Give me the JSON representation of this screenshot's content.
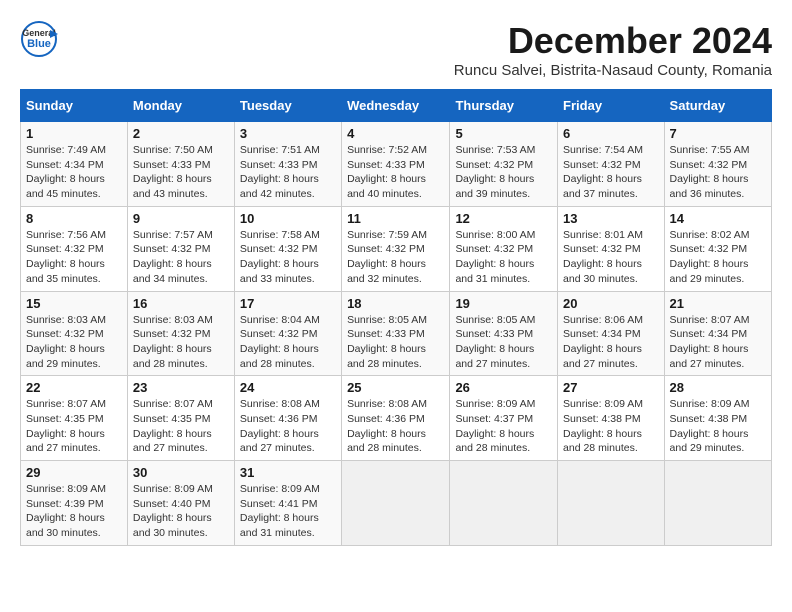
{
  "header": {
    "logo_general": "General",
    "logo_blue": "Blue",
    "month_title": "December 2024",
    "subtitle": "Runcu Salvei, Bistrita-Nasaud County, Romania"
  },
  "days_of_week": [
    "Sunday",
    "Monday",
    "Tuesday",
    "Wednesday",
    "Thursday",
    "Friday",
    "Saturday"
  ],
  "weeks": [
    [
      {
        "day": "1",
        "rise": "7:49 AM",
        "set": "4:34 PM",
        "daylight": "8 hours and 45 minutes."
      },
      {
        "day": "2",
        "rise": "7:50 AM",
        "set": "4:33 PM",
        "daylight": "8 hours and 43 minutes."
      },
      {
        "day": "3",
        "rise": "7:51 AM",
        "set": "4:33 PM",
        "daylight": "8 hours and 42 minutes."
      },
      {
        "day": "4",
        "rise": "7:52 AM",
        "set": "4:33 PM",
        "daylight": "8 hours and 40 minutes."
      },
      {
        "day": "5",
        "rise": "7:53 AM",
        "set": "4:32 PM",
        "daylight": "8 hours and 39 minutes."
      },
      {
        "day": "6",
        "rise": "7:54 AM",
        "set": "4:32 PM",
        "daylight": "8 hours and 37 minutes."
      },
      {
        "day": "7",
        "rise": "7:55 AM",
        "set": "4:32 PM",
        "daylight": "8 hours and 36 minutes."
      }
    ],
    [
      {
        "day": "8",
        "rise": "7:56 AM",
        "set": "4:32 PM",
        "daylight": "8 hours and 35 minutes."
      },
      {
        "day": "9",
        "rise": "7:57 AM",
        "set": "4:32 PM",
        "daylight": "8 hours and 34 minutes."
      },
      {
        "day": "10",
        "rise": "7:58 AM",
        "set": "4:32 PM",
        "daylight": "8 hours and 33 minutes."
      },
      {
        "day": "11",
        "rise": "7:59 AM",
        "set": "4:32 PM",
        "daylight": "8 hours and 32 minutes."
      },
      {
        "day": "12",
        "rise": "8:00 AM",
        "set": "4:32 PM",
        "daylight": "8 hours and 31 minutes."
      },
      {
        "day": "13",
        "rise": "8:01 AM",
        "set": "4:32 PM",
        "daylight": "8 hours and 30 minutes."
      },
      {
        "day": "14",
        "rise": "8:02 AM",
        "set": "4:32 PM",
        "daylight": "8 hours and 29 minutes."
      }
    ],
    [
      {
        "day": "15",
        "rise": "8:03 AM",
        "set": "4:32 PM",
        "daylight": "8 hours and 29 minutes."
      },
      {
        "day": "16",
        "rise": "8:03 AM",
        "set": "4:32 PM",
        "daylight": "8 hours and 28 minutes."
      },
      {
        "day": "17",
        "rise": "8:04 AM",
        "set": "4:32 PM",
        "daylight": "8 hours and 28 minutes."
      },
      {
        "day": "18",
        "rise": "8:05 AM",
        "set": "4:33 PM",
        "daylight": "8 hours and 28 minutes."
      },
      {
        "day": "19",
        "rise": "8:05 AM",
        "set": "4:33 PM",
        "daylight": "8 hours and 27 minutes."
      },
      {
        "day": "20",
        "rise": "8:06 AM",
        "set": "4:34 PM",
        "daylight": "8 hours and 27 minutes."
      },
      {
        "day": "21",
        "rise": "8:07 AM",
        "set": "4:34 PM",
        "daylight": "8 hours and 27 minutes."
      }
    ],
    [
      {
        "day": "22",
        "rise": "8:07 AM",
        "set": "4:35 PM",
        "daylight": "8 hours and 27 minutes."
      },
      {
        "day": "23",
        "rise": "8:07 AM",
        "set": "4:35 PM",
        "daylight": "8 hours and 27 minutes."
      },
      {
        "day": "24",
        "rise": "8:08 AM",
        "set": "4:36 PM",
        "daylight": "8 hours and 27 minutes."
      },
      {
        "day": "25",
        "rise": "8:08 AM",
        "set": "4:36 PM",
        "daylight": "8 hours and 28 minutes."
      },
      {
        "day": "26",
        "rise": "8:09 AM",
        "set": "4:37 PM",
        "daylight": "8 hours and 28 minutes."
      },
      {
        "day": "27",
        "rise": "8:09 AM",
        "set": "4:38 PM",
        "daylight": "8 hours and 28 minutes."
      },
      {
        "day": "28",
        "rise": "8:09 AM",
        "set": "4:38 PM",
        "daylight": "8 hours and 29 minutes."
      }
    ],
    [
      {
        "day": "29",
        "rise": "8:09 AM",
        "set": "4:39 PM",
        "daylight": "8 hours and 30 minutes."
      },
      {
        "day": "30",
        "rise": "8:09 AM",
        "set": "4:40 PM",
        "daylight": "8 hours and 30 minutes."
      },
      {
        "day": "31",
        "rise": "8:09 AM",
        "set": "4:41 PM",
        "daylight": "8 hours and 31 minutes."
      },
      null,
      null,
      null,
      null
    ]
  ]
}
